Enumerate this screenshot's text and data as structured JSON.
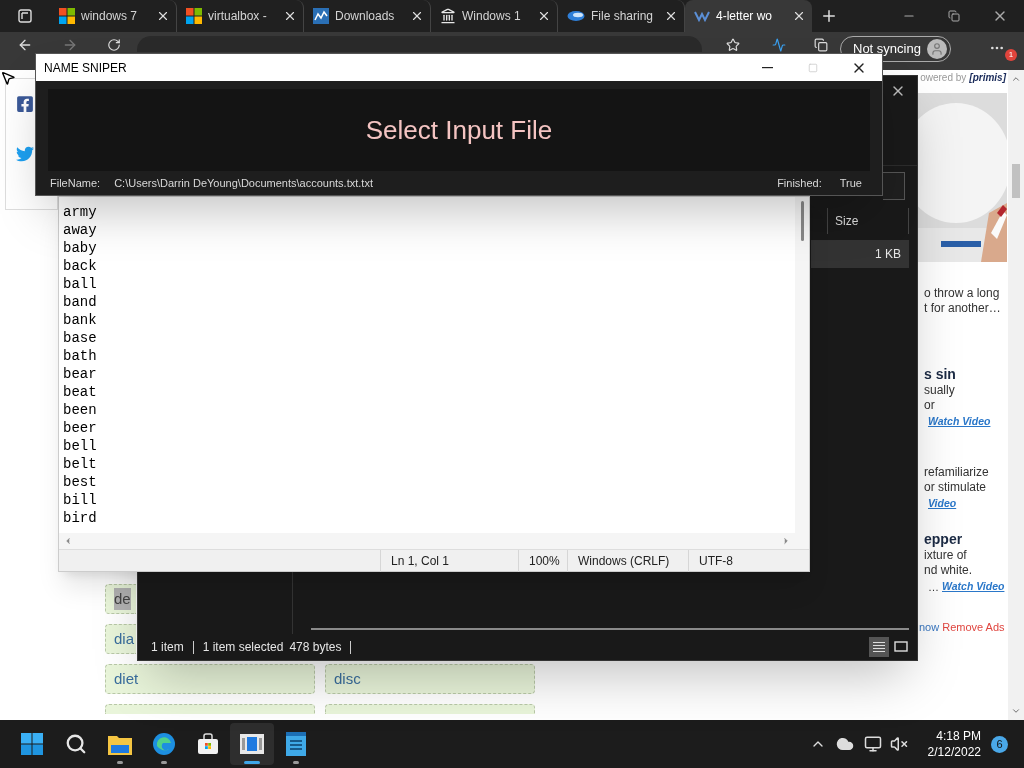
{
  "browser": {
    "tabs": [
      {
        "label": "windows 7",
        "kind": "windows",
        "selected": false
      },
      {
        "label": "virtualbox -",
        "kind": "windows",
        "selected": false
      },
      {
        "label": "Downloads",
        "kind": "chart",
        "selected": false
      },
      {
        "label": "Windows 1",
        "kind": "landmark",
        "selected": false
      },
      {
        "label": "File sharing",
        "kind": "swirl",
        "selected": false
      },
      {
        "label": "4-letter wo",
        "kind": "letter",
        "selected": true
      }
    ],
    "sync_button": "Not syncing",
    "menu_badge": "1"
  },
  "page": {
    "word_tiles": [
      [
        {
          "label": "de",
          "highlighted": true
        }
      ],
      [
        {
          "label": "dia",
          "highlighted": false
        }
      ],
      [
        {
          "label": "diet",
          "highlighted": false
        },
        {
          "label": "disc",
          "highlighted": false
        }
      ]
    ],
    "ad": {
      "powered_by": "owered by",
      "brand": "[primis]",
      "articles": [
        {
          "lines": [
            "o throw a long",
            "t for another…"
          ]
        },
        {
          "title": "s sin",
          "lines": [
            "sually",
            "or"
          ],
          "link": "Watch Video"
        },
        {
          "lines": [
            "refamiliarize",
            "or stimulate"
          ],
          "link": "Video"
        },
        {
          "title": "epper",
          "lines": [
            "ixture of",
            "nd white."
          ],
          "link_prefix": "…",
          "link": "Watch Video"
        }
      ],
      "footer_link": "now",
      "remove_ads": "Remove Ads"
    }
  },
  "explorer": {
    "columns": [
      "Size"
    ],
    "rows": [
      {
        "size": "1 KB",
        "selected": true
      }
    ],
    "status": [
      "1 item",
      "1 item selected",
      "478 bytes"
    ],
    "view_modes": [
      {
        "kind": "details",
        "selected": true
      },
      {
        "kind": "tiles",
        "selected": false
      }
    ]
  },
  "notepad": {
    "lines": [
      "army",
      "away",
      "baby",
      "back",
      "ball",
      "band",
      "bank",
      "base",
      "bath",
      "bear",
      "beat",
      "been",
      "beer",
      "bell",
      "belt",
      "best",
      "bill",
      "bird"
    ],
    "status": [
      "Ln 1, Col 1",
      "100%",
      "Windows (CRLF)",
      "UTF-8"
    ]
  },
  "name_sniper": {
    "title": "NAME SNIPER",
    "button": "Select Input File",
    "file_label": "FileName:",
    "file_path": "C:\\Users\\Darrin DeYoung\\Documents\\accounts.txt.txt",
    "finished_label": "Finished:",
    "finished_value": "True"
  },
  "taskbar": {
    "apps": [
      {
        "kind": "start",
        "running": false,
        "selected": false
      },
      {
        "kind": "search",
        "running": false,
        "selected": false
      },
      {
        "kind": "folder",
        "running": true,
        "selected": false
      },
      {
        "kind": "edge",
        "running": true,
        "selected": false
      },
      {
        "kind": "store",
        "running": false,
        "selected": false
      },
      {
        "kind": "app",
        "running": true,
        "selected": true
      },
      {
        "kind": "notepad",
        "running": true,
        "selected": false
      }
    ],
    "time": "4:18 PM",
    "date": "2/12/2022",
    "notifications": "6"
  }
}
